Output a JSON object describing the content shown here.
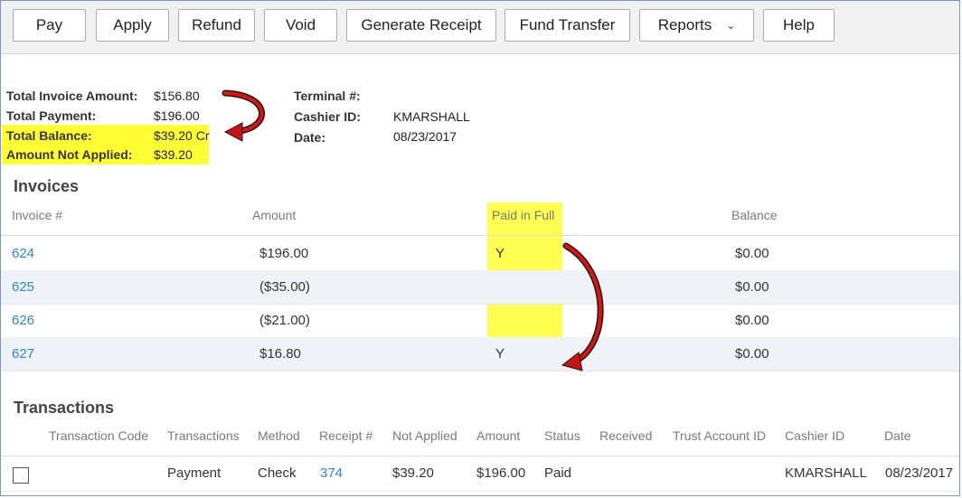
{
  "toolbar": {
    "buttons": [
      "Pay",
      "Apply",
      "Refund",
      "Void",
      "Generate Receipt",
      "Fund Transfer",
      "Reports",
      "Help"
    ]
  },
  "summary": {
    "total_invoice_label": "Total Invoice Amount:",
    "total_invoice_value": "$156.80",
    "total_payment_label": "Total Payment:",
    "total_payment_value": "$196.00",
    "total_balance_label": "Total Balance:",
    "total_balance_value": "$39.20 Cr",
    "amount_not_applied_label": "Amount Not Applied:",
    "amount_not_applied_value": "$39.20"
  },
  "meta": {
    "terminal_label": "Terminal #:",
    "terminal_value": "",
    "cashier_label": "Cashier ID:",
    "cashier_value": "KMARSHALL",
    "date_label": "Date:",
    "date_value": "08/23/2017"
  },
  "invoices": {
    "title": "Invoices",
    "columns": [
      "Invoice #",
      "Amount",
      "Paid in Full",
      "Balance"
    ],
    "rows": [
      {
        "invoice": "624",
        "amount": "$196.00",
        "paid_in_full": "Y",
        "balance": "$0.00"
      },
      {
        "invoice": "625",
        "amount": "($35.00)",
        "paid_in_full": "",
        "balance": "$0.00"
      },
      {
        "invoice": "626",
        "amount": "($21.00)",
        "paid_in_full": "",
        "balance": "$0.00"
      },
      {
        "invoice": "627",
        "amount": "$16.80",
        "paid_in_full": "Y",
        "balance": "$0.00"
      }
    ]
  },
  "transactions": {
    "title": "Transactions",
    "columns": [
      "Transaction Code",
      "Transactions",
      "Method",
      "Receipt #",
      "Not Applied",
      "Amount",
      "Status",
      "Received",
      "Trust Account ID",
      "Cashier ID",
      "Date"
    ],
    "rows": [
      {
        "transaction_code": "",
        "transaction": "Payment",
        "method": "Check",
        "receipt": "374",
        "not_applied": "$39.20",
        "amount": "$196.00",
        "status": "Paid",
        "received": "",
        "trust_account_id": "",
        "cashier_id": "KMARSHALL",
        "date": "08/23/2017"
      }
    ]
  },
  "colors": {
    "highlight": "#ffff33",
    "link": "#2d87c8",
    "arrow": "#cc1111"
  },
  "icons": {
    "reports_dropdown": "chevron-down-icon",
    "row_select": "checkbox-icon"
  }
}
